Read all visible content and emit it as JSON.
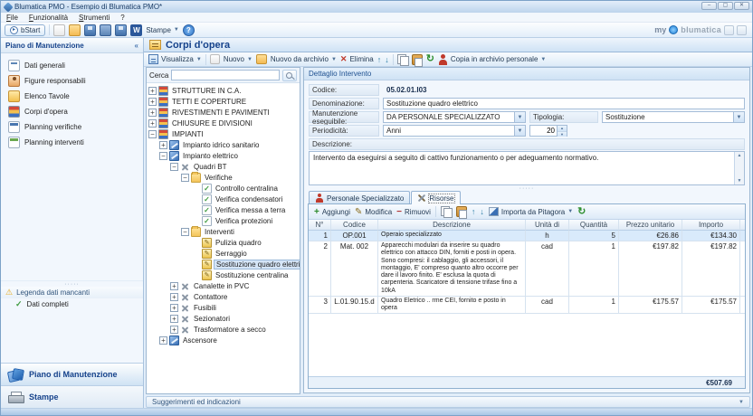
{
  "window": {
    "title": "Blumatica PMO - Esempio di Blumatica PMO*",
    "menu": [
      "File",
      "Funzionalità",
      "Strumenti",
      "?"
    ],
    "toolbar": {
      "bstart": "bStart",
      "stampe": "Stampe"
    },
    "brand": {
      "my": "my",
      "name": "blumatica"
    }
  },
  "sidebar": {
    "header": "Piano di Manutenzione",
    "items": [
      {
        "label": "Dati generali"
      },
      {
        "label": "Figure responsabili"
      },
      {
        "label": "Elenco Tavole"
      },
      {
        "label": "Corpi d'opera"
      },
      {
        "label": "Planning verifiche"
      },
      {
        "label": "Planning interventi"
      }
    ],
    "legend": {
      "header": "Legenda dati mancanti",
      "item": "Dati completi"
    },
    "sections": [
      {
        "label": "Piano di Manutenzione"
      },
      {
        "label": "Stampe"
      }
    ]
  },
  "main": {
    "title": "Corpi d'opera",
    "toolbar": {
      "visualizza": "Visualizza",
      "nuovo": "Nuovo",
      "nuovo_da_archivio": "Nuovo da archivio",
      "elimina": "Elimina",
      "copia_archivio": "Copia in archivio personale"
    },
    "search_label": "Cerca",
    "tree": [
      {
        "level": 0,
        "expand": "+",
        "icon": "category",
        "label": "STRUTTURE IN C.A."
      },
      {
        "level": 0,
        "expand": "+",
        "icon": "category",
        "label": "TETTI E COPERTURE"
      },
      {
        "level": 0,
        "expand": "+",
        "icon": "category",
        "label": "RIVESTIMENTI E PAVIMENTI"
      },
      {
        "level": 0,
        "expand": "+",
        "icon": "category",
        "label": "CHIUSURE E DIVISIONI"
      },
      {
        "level": 0,
        "expand": "-",
        "icon": "category",
        "label": "IMPIANTI"
      },
      {
        "level": 1,
        "expand": "+",
        "icon": "system",
        "label": "Impianto idrico sanitario"
      },
      {
        "level": 1,
        "expand": "-",
        "icon": "system",
        "label": "Impianto elettrico"
      },
      {
        "level": 2,
        "expand": "-",
        "icon": "component",
        "label": "Quadri BT"
      },
      {
        "level": 3,
        "expand": "-",
        "icon": "folder",
        "label": "Verifiche"
      },
      {
        "level": 4,
        "expand": null,
        "icon": "check",
        "label": "Controllo centralina"
      },
      {
        "level": 4,
        "expand": null,
        "icon": "check",
        "label": "Verifica condensatori"
      },
      {
        "level": 4,
        "expand": null,
        "icon": "check",
        "label": "Verifica messa a terra"
      },
      {
        "level": 4,
        "expand": null,
        "icon": "check",
        "label": "Verifica protezioni"
      },
      {
        "level": 3,
        "expand": "-",
        "icon": "folder",
        "label": "Interventi"
      },
      {
        "level": 4,
        "expand": null,
        "icon": "intervention",
        "label": "Pulizia quadro"
      },
      {
        "level": 4,
        "expand": null,
        "icon": "intervention",
        "label": "Serraggio"
      },
      {
        "level": 4,
        "expand": null,
        "icon": "intervention",
        "label": "Sostituzione quadro elettrico",
        "selected": true
      },
      {
        "level": 4,
        "expand": null,
        "icon": "intervention",
        "label": "Sostituzione centralina"
      },
      {
        "level": 2,
        "expand": "+",
        "icon": "component",
        "label": "Canalette in PVC"
      },
      {
        "level": 2,
        "expand": "+",
        "icon": "component",
        "label": "Contattore"
      },
      {
        "level": 2,
        "expand": "+",
        "icon": "component",
        "label": "Fusibili"
      },
      {
        "level": 2,
        "expand": "+",
        "icon": "component",
        "label": "Sezionatori"
      },
      {
        "level": 2,
        "expand": "+",
        "icon": "component",
        "label": "Trasformatore a secco"
      },
      {
        "level": 1,
        "expand": "+",
        "icon": "system",
        "label": "Ascensore"
      }
    ],
    "detail": {
      "header": "Dettaglio Intervento",
      "fields": {
        "codice_label": "Codice:",
        "codice": "05.02.01.I03",
        "denominazione_label": "Denominazione:",
        "denominazione": "Sostituzione quadro elettrico",
        "manutenzione_label": "Manutenzione eseguibile:",
        "manutenzione": "DA PERSONALE SPECIALIZZATO",
        "tipologia_label": "Tipologia:",
        "tipologia": "Sostituzione",
        "periodicita_label": "Periodicità:",
        "periodicita_unit": "Anni",
        "periodicita_value": "20",
        "descrizione_label": "Descrizione:",
        "descrizione": "Intervento da eseguirsi a seguito di cattivo funzionamento o per adeguamento normativo."
      },
      "tabs": [
        {
          "label": "Personale Specializzato",
          "active": false
        },
        {
          "label": "Risorse",
          "active": true
        }
      ],
      "table_toolbar": {
        "aggiungi": "Aggiungi",
        "modifica": "Modifica",
        "rimuovi": "Rimuovi",
        "importa": "Importa da Pitagora"
      },
      "table": {
        "headers": [
          "N°",
          "Codice",
          "Descrizione",
          "Unità di misura",
          "Quantità",
          "Prezzo unitario",
          "Importo"
        ],
        "rows": [
          {
            "n": "1",
            "codice": "OP.001",
            "descrizione": "Operaio specializzato",
            "um": "h",
            "qta": "5",
            "prezzo": "€26.86",
            "importo": "€134.30",
            "selected": true
          },
          {
            "n": "2",
            "codice": "Mat. 002",
            "descrizione": "Apparecchi modulari da inserire su quadro elettrico con attacco DIN, forniti e posti in opera. Sono compresi: il cablaggio, gli accessori, il montaggio, E' compreso quanto altro occorre per dare il lavoro finito. E' esclusa la quota di carpenteria. Scaricatore di tensione trifase fino a 10kA",
            "um": "cad",
            "qta": "1",
            "prezzo": "€197.82",
            "importo": "€197.82",
            "selected": false
          },
          {
            "n": "3",
            "codice": "L.01.90.15.d",
            "descrizione": "Quadro Eletrico .. rme CEI, fornito e posto in opera",
            "um": "cad",
            "qta": "1",
            "prezzo": "€175.57",
            "importo": "€175.57",
            "selected": false
          }
        ],
        "total": "€507.69"
      }
    },
    "footer": "Suggerimenti ed indicazioni"
  }
}
